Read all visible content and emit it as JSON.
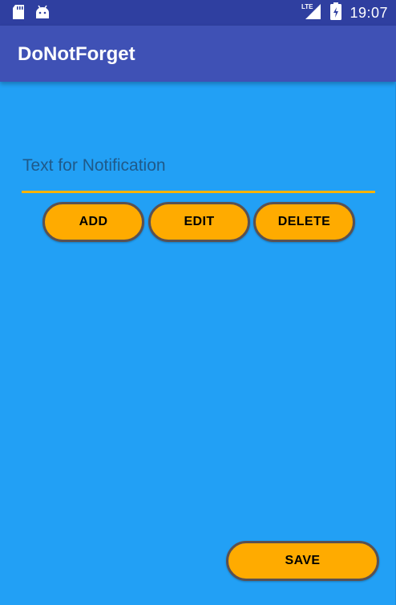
{
  "status_bar": {
    "time": "19:07",
    "network": "LTE",
    "icons": [
      "sd-card-icon",
      "android-icon",
      "lte-signal-icon",
      "battery-charging-icon"
    ]
  },
  "app_bar": {
    "title": "DoNotForget"
  },
  "form": {
    "notification_placeholder": "Text for Notification",
    "notification_value": ""
  },
  "actions": {
    "add_label": "ADD",
    "edit_label": "EDIT",
    "delete_label": "DELETE",
    "save_label": "SAVE"
  },
  "colors": {
    "status_bar": "#2f3fa0",
    "app_bar": "#3f51b5",
    "background": "#22a0f5",
    "accent": "#ffab00",
    "button_border": "#5a5152"
  }
}
